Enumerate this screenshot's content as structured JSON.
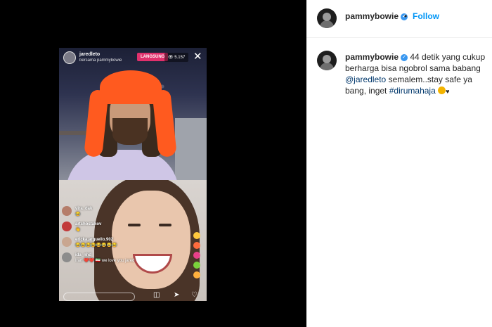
{
  "post": {
    "username": "pammybowie",
    "follow_label": "Follow",
    "dot": "•",
    "caption": {
      "username": "pammybowie",
      "text_before": "44 detik yang cukup berharga bisa ngobrol sama babang",
      "mention": "@jaredleto",
      "text_middle": "semalem..stay safe ya bang, inget",
      "hashtag": "#dirumahaja",
      "heart": "♥"
    }
  },
  "live": {
    "host_username": "jaredleto",
    "with_text": "bersama pammybowie",
    "live_badge": "LANGSUNG",
    "viewer_count": "5.157",
    "close_glyph": "✕",
    "comments": [
      {
        "user": "vira_dak",
        "message": "😂",
        "avatar_color": "#b57d6a"
      },
      {
        "user": "artshostakov",
        "message": "👋",
        "avatar_color": "#c23a3a"
      },
      {
        "user": "ericka.arguello.902",
        "message": "😂😂😂😂😂😂😂😂",
        "avatar_color": "#c9a690"
      },
      {
        "user": "ida_nhd",
        "message": "Iran ❤️❤️ 🇮🇷 we love you jared",
        "avatar_color": "#8c8c8c"
      }
    ],
    "heart_colors": [
      "#ffc83d",
      "#ff6b3d",
      "#e8408a",
      "#7ad13b",
      "#ffb03d"
    ]
  }
}
